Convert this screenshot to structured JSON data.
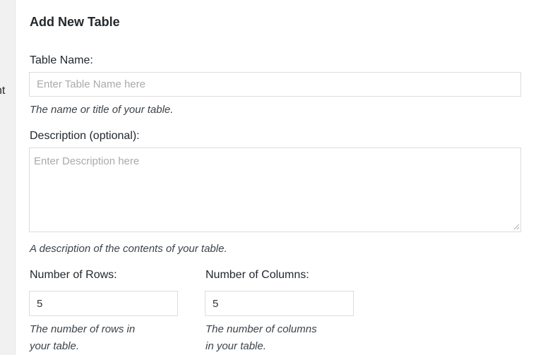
{
  "left_fragment": "nt",
  "panel": {
    "title": "Add New Table"
  },
  "table_name": {
    "label": "Table Name:",
    "placeholder": "Enter Table Name here",
    "value": "",
    "hint": "The name or title of your table."
  },
  "description": {
    "label": "Description (optional):",
    "placeholder": "Enter Description here",
    "value": "",
    "hint": "A description of the contents of your table."
  },
  "rows": {
    "label": "Number of Rows:",
    "value": "5",
    "hint_line1": "The number of rows in",
    "hint_line2": "your table."
  },
  "columns": {
    "label": "Number of Columns:",
    "value": "5",
    "hint_line1": "The number of columns",
    "hint_line2": "in your table."
  },
  "icons": {
    "resize": "resize-grip-icon"
  }
}
